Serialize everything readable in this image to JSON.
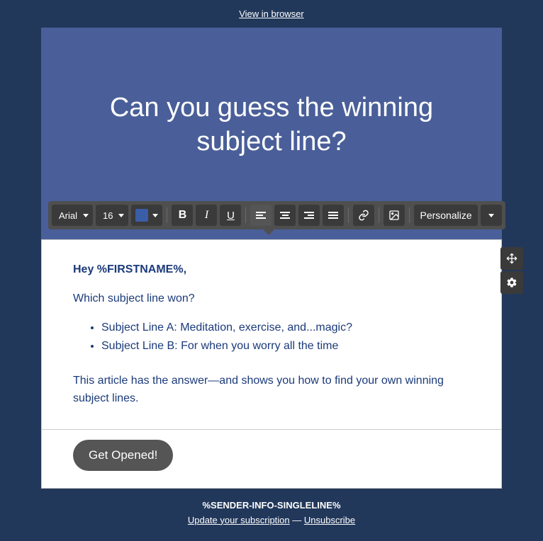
{
  "topLink": "View in browser",
  "hero": {
    "title": "Can you guess the winning subject line?"
  },
  "toolbar": {
    "font": "Arial",
    "size": "16",
    "personalize": "Personalize",
    "bold": "B",
    "italic": "I",
    "underline": "U"
  },
  "body": {
    "greeting": "Hey %FIRSTNAME%,",
    "question": "Which subject line won?",
    "bulletA": "Subject Line A: Meditation, exercise, and...magic?",
    "bulletB": "Subject Line B: For when you worry all the time",
    "closing": "This article has the answer—and shows you how to find your own winning subject lines."
  },
  "cta": {
    "label": "Get Opened!"
  },
  "footer": {
    "sender": "%SENDER-INFO-SINGLELINE%",
    "update": "Update your subscription",
    "separator": " — ",
    "unsubscribe": "Unsubscribe"
  }
}
